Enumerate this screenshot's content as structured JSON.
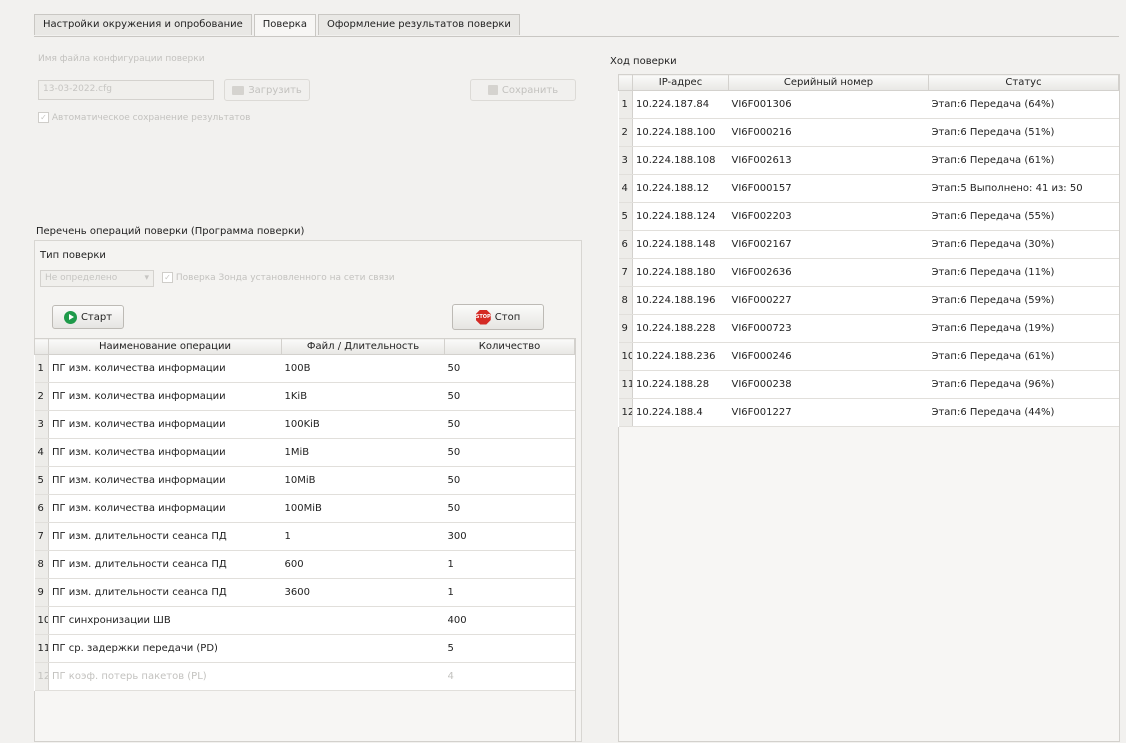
{
  "tabs": [
    {
      "label": "Настройки окружения и опробование",
      "active": false
    },
    {
      "label": "Поверка",
      "active": true
    },
    {
      "label": "Оформление результатов поверки",
      "active": false
    }
  ],
  "config": {
    "file_label": "Имя файла конфигурации поверки",
    "file_value": "13-03-2022.cfg",
    "load_label": "Загрузить",
    "save_label": "Сохранить",
    "autosave_label": "Автоматическое сохранение результатов",
    "autosave_checked": true
  },
  "operations": {
    "section_title": "Перечень операций поверки (Программа поверки)",
    "type_label": "Тип поверки",
    "type_value": "Не определено",
    "probe_check_label": "Поверка Зонда установленного на сети связи",
    "start_label": "Старт",
    "stop_label": "Стоп",
    "stop_icon_text": "STOP",
    "columns": [
      "Наименование операции",
      "Файл / Длительность",
      "Количество"
    ],
    "rows": [
      {
        "n": "1",
        "name": "ПГ изм. количества информации",
        "file": "100B",
        "count": "50",
        "disabled": false
      },
      {
        "n": "2",
        "name": "ПГ изм. количества информации",
        "file": "1KiB",
        "count": "50",
        "disabled": false
      },
      {
        "n": "3",
        "name": "ПГ изм. количества информации",
        "file": "100KiB",
        "count": "50",
        "disabled": false
      },
      {
        "n": "4",
        "name": "ПГ изм. количества информации",
        "file": "1MiB",
        "count": "50",
        "disabled": false
      },
      {
        "n": "5",
        "name": "ПГ изм. количества информации",
        "file": "10MiB",
        "count": "50",
        "disabled": false
      },
      {
        "n": "6",
        "name": "ПГ изм. количества информации",
        "file": "100MiB",
        "count": "50",
        "disabled": false
      },
      {
        "n": "7",
        "name": "ПГ изм. длительности сеанса ПД",
        "file": "1",
        "count": "300",
        "disabled": false
      },
      {
        "n": "8",
        "name": "ПГ изм. длительности сеанса ПД",
        "file": "600",
        "count": "1",
        "disabled": false
      },
      {
        "n": "9",
        "name": "ПГ изм. длительности сеанса ПД",
        "file": "3600",
        "count": "1",
        "disabled": false
      },
      {
        "n": "10",
        "name": "ПГ синхронизации ШВ",
        "file": "",
        "count": "400",
        "disabled": false
      },
      {
        "n": "11",
        "name": "ПГ ср. задержки передачи (PD)",
        "file": "",
        "count": "5",
        "disabled": false
      },
      {
        "n": "12",
        "name": "ПГ коэф. потерь пакетов (PL)",
        "file": "",
        "count": "4",
        "disabled": true
      }
    ]
  },
  "progress": {
    "title": "Ход поверки",
    "columns": [
      "IP-адрес",
      "Серийный номер",
      "Статус"
    ],
    "rows": [
      {
        "n": "1",
        "ip": "10.224.187.84",
        "serial": "VI6F001306",
        "status": "Этап:6 Передача (64%)"
      },
      {
        "n": "2",
        "ip": "10.224.188.100",
        "serial": "VI6F000216",
        "status": "Этап:6 Передача (51%)"
      },
      {
        "n": "3",
        "ip": "10.224.188.108",
        "serial": "VI6F002613",
        "status": "Этап:6 Передача (61%)"
      },
      {
        "n": "4",
        "ip": "10.224.188.12",
        "serial": "VI6F000157",
        "status": "Этап:5 Выполнено: 41 из: 50"
      },
      {
        "n": "5",
        "ip": "10.224.188.124",
        "serial": "VI6F002203",
        "status": "Этап:6 Передача (55%)"
      },
      {
        "n": "6",
        "ip": "10.224.188.148",
        "serial": "VI6F002167",
        "status": "Этап:6 Передача (30%)"
      },
      {
        "n": "7",
        "ip": "10.224.188.180",
        "serial": "VI6F002636",
        "status": "Этап:6 Передача (11%)"
      },
      {
        "n": "8",
        "ip": "10.224.188.196",
        "serial": "VI6F000227",
        "status": "Этап:6 Передача (59%)"
      },
      {
        "n": "9",
        "ip": "10.224.188.228",
        "serial": "VI6F000723",
        "status": "Этап:6 Передача (19%)"
      },
      {
        "n": "10",
        "ip": "10.224.188.236",
        "serial": "VI6F000246",
        "status": "Этап:6 Передача (61%)"
      },
      {
        "n": "11",
        "ip": "10.224.188.28",
        "serial": "VI6F000238",
        "status": "Этап:6 Передача (96%)"
      },
      {
        "n": "12",
        "ip": "10.224.188.4",
        "serial": "VI6F001227",
        "status": "Этап:6 Передача (44%)"
      }
    ]
  }
}
